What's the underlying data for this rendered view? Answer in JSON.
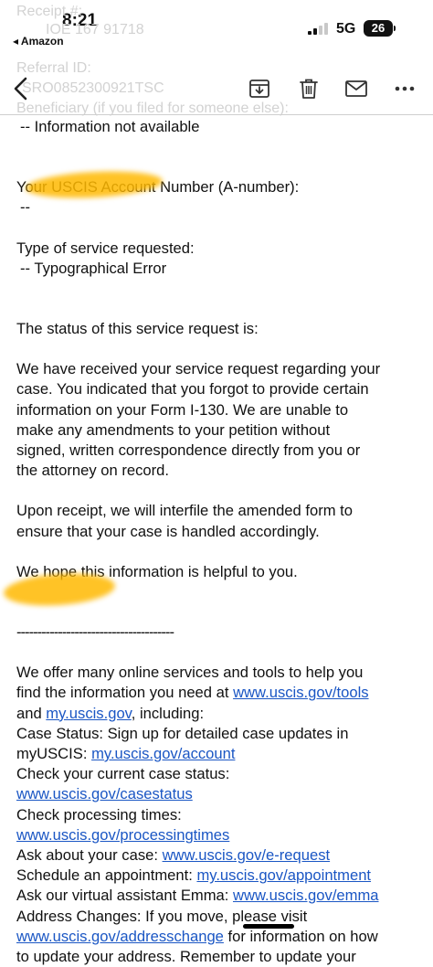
{
  "status_bar": {
    "time": "8:21",
    "back_app": "◂ Amazon",
    "network": "5G",
    "battery": "26"
  },
  "toolbar": {
    "back_icon": "chevron-left-icon",
    "archive_icon": "archive-download-icon",
    "trash_icon": "trash-icon",
    "reply_icon": "mail-icon",
    "more_icon": "ellipsis-icon"
  },
  "ghost_header": {
    "receipt": "Receipt #:",
    "receipt_value": "IOE  167 91718",
    "referral": "Referral ID:",
    "referral_value": "SRO0852300921TSC",
    "beneficiary": "Beneficiary (if you filed for someone else):"
  },
  "email": {
    "beneficiary_value": "-- Information not available",
    "account_label": "Your USCIS Account Number (A-number):",
    "account_value": "--",
    "service_label": "Type of service requested:",
    "service_value": "-- Typographical Error",
    "status_intro": "The status of this service request is:",
    "p1_l1": "We have received your service request regarding your",
    "p1_l2": "case. You indicated that you forgot to provide certain",
    "p1_l3": "information on your Form I-130. We are unable to",
    "p1_l4": "make any amendments to your petition without",
    "p1_l5": "signed, written correspondence directly from you or",
    "p1_l6": "the attorney on record.",
    "p2_l1": "Upon receipt, we will interfile the amended form to",
    "p2_l2": "ensure that your case is handled accordingly.",
    "p3": "We hope this information is helpful to you.",
    "separator": "--------------------------------------",
    "s_l1": "We offer many online services and tools to help you",
    "s_l2_text": "find the information you need at ",
    "s_l2_link": "www.uscis.gov/tools",
    "s_l3_and": "and ",
    "s_l3_link": "my.uscis.gov",
    "s_l3_tail": ", including:",
    "s_l4": "Case Status: Sign up for detailed case updates in",
    "s_l5_text": "myUSCIS: ",
    "s_l5_link": "my.uscis.gov/account",
    "s_l6": "Check your current case status:",
    "s_l7_link": "www.uscis.gov/casestatus",
    "s_l8": "Check processing times:",
    "s_l9_link": "www.uscis.gov/processingtimes",
    "s_l10_text": "Ask about your case: ",
    "s_l10_link": "www.uscis.gov/e-request",
    "s_l11_text": "Schedule an appointment: ",
    "s_l11_link": "my.uscis.gov/appointment",
    "s_l12_text": "Ask our virtual assistant Emma: ",
    "s_l12_link": "www.uscis.gov/emma",
    "s_l13": "Address Changes: If you move, please visit",
    "s_l14_link": "www.uscis.gov/addresschange",
    "s_l14_tail": " for information on how",
    "s_l15": "to update your address. Remember to update your"
  }
}
